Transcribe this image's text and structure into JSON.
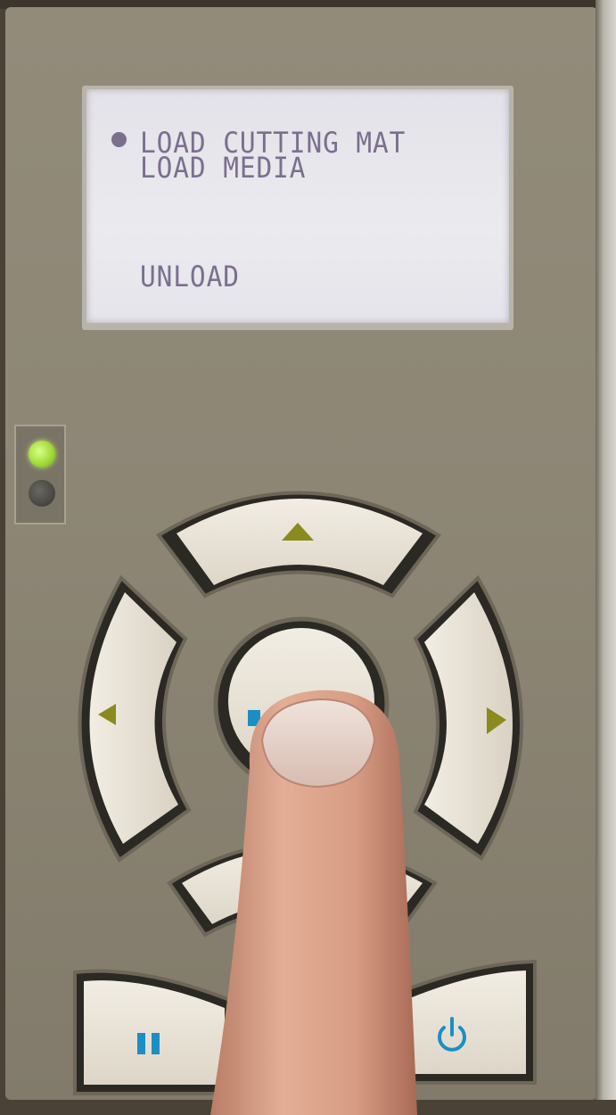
{
  "display": {
    "lines": [
      "LOAD CUTTING MAT",
      "LOAD MEDIA",
      "UNLOAD"
    ],
    "selected_index": 0
  },
  "indicators": {
    "status_led_color": "#9ed832",
    "second_led_color": "#45443f"
  },
  "buttons": {
    "up_icon": "triangle-up-icon",
    "left_icon": "triangle-left-icon",
    "right_icon": "triangle-right-icon",
    "enter_icon": "enter-icon",
    "down_icon": "triangle-down-icon",
    "pause_icon": "pause-icon",
    "power_icon": "power-icon"
  },
  "colors": {
    "panel": "#8d8675",
    "key": "#e8e2d6",
    "arrow": "#8a8a1e",
    "blue": "#1b8fc4",
    "lcd_text": "#7b6f8e"
  }
}
